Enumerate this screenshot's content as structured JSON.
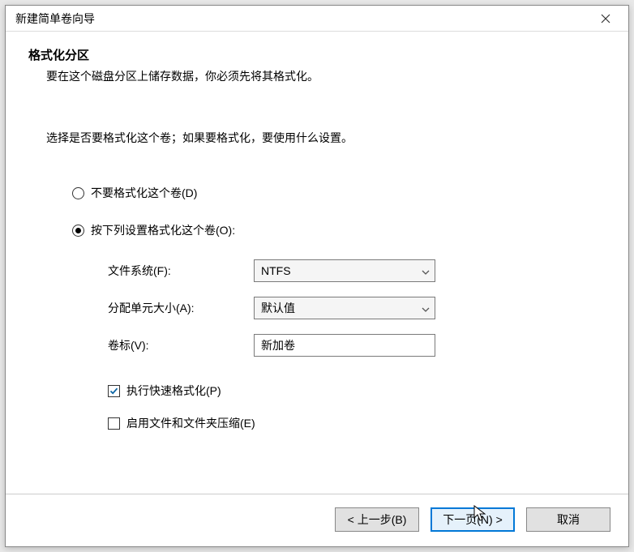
{
  "window": {
    "title": "新建简单卷向导"
  },
  "header": {
    "title": "格式化分区",
    "desc": "要在这个磁盘分区上储存数据，你必须先将其格式化。"
  },
  "prompt": "选择是否要格式化这个卷；如果要格式化，要使用什么设置。",
  "radios": {
    "no_format": "不要格式化这个卷(D)",
    "do_format": "按下列设置格式化这个卷(O):"
  },
  "form": {
    "fs_label": "文件系统(F):",
    "fs_value": "NTFS",
    "au_label": "分配单元大小(A):",
    "au_value": "默认值",
    "vol_label": "卷标(V):",
    "vol_value": "新加卷",
    "quick_label": "执行快速格式化(P)",
    "compress_label": "启用文件和文件夹压缩(E)"
  },
  "buttons": {
    "back": "< 上一步(B)",
    "next": "下一页(N) >",
    "cancel": "取消"
  }
}
